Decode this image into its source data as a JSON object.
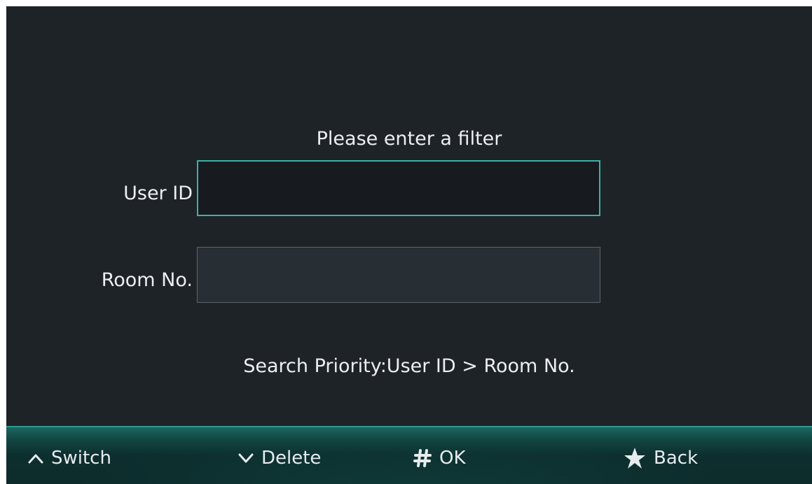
{
  "form": {
    "title": "Please enter a filter",
    "user_id_label": "User ID",
    "user_id_value": "",
    "room_label": "Room No.",
    "room_value": "",
    "priority_note": "Search Priority:User ID > Room No."
  },
  "footer": {
    "switch_label": "Switch",
    "switch_icon": "chevron-up-icon",
    "delete_label": "Delete",
    "delete_icon": "chevron-down-icon",
    "ok_label": "OK",
    "ok_icon": "hash-icon",
    "back_label": "Back",
    "back_icon": "asterisk-icon"
  },
  "colors": {
    "background": "#1e2328",
    "accent": "#3ab3a2",
    "text": "#eceff1",
    "footer": "#0d2f2e"
  }
}
